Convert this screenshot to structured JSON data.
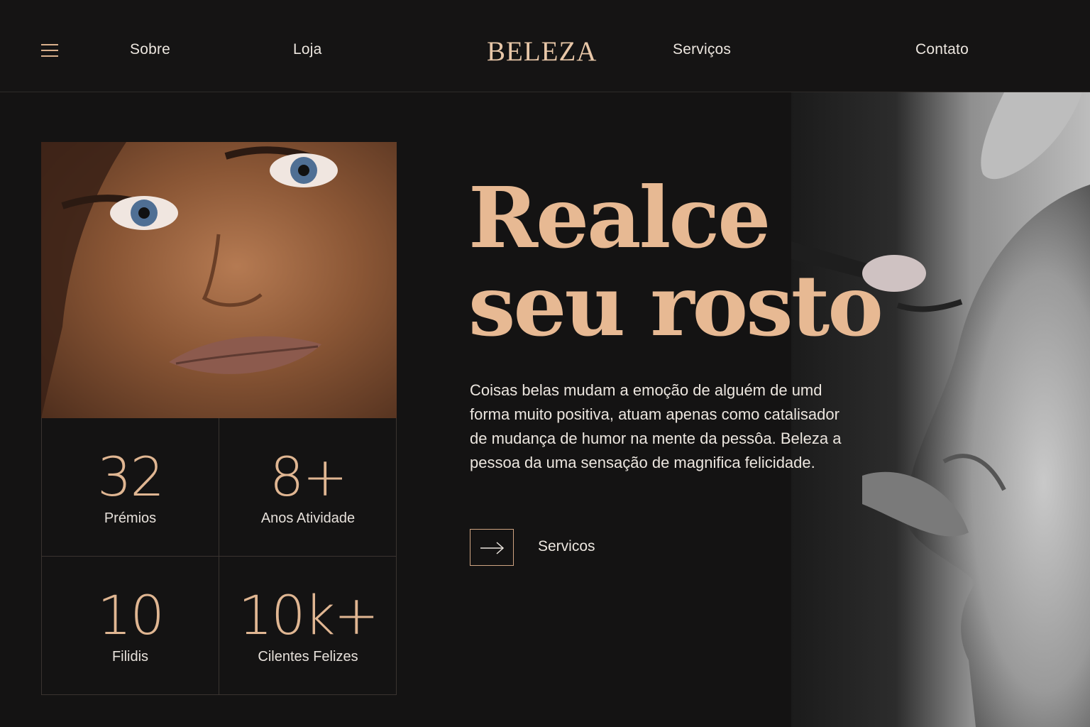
{
  "nav": {
    "menu_icon": "hamburger-icon",
    "links": [
      "Sobre",
      "Loja",
      "Serviços",
      "Contato"
    ],
    "brand": "BELEZA"
  },
  "hero": {
    "headline_line1": "Realce",
    "headline_line2": "seu rosto",
    "body": "Coisas belas mudam a emoção de alguém de umd forma muito positiva, atuam apenas como catalisador de mudança de humor na mente da pessôa. Beleza a pessoa da uma sensação de magnifica felicidade.",
    "cta_icon": "arrow-right-icon",
    "cta_label": "Servicos"
  },
  "stats": [
    {
      "value": "32",
      "label": "Prémios"
    },
    {
      "value": "8+",
      "label": "Anos Atividade"
    },
    {
      "value": "10",
      "label": "Filidis"
    },
    {
      "value": "10k+",
      "label": "Cilentes Felizes"
    }
  ],
  "colors": {
    "background": "#141313",
    "accent": "#e7b993",
    "text": "#ece6df"
  }
}
